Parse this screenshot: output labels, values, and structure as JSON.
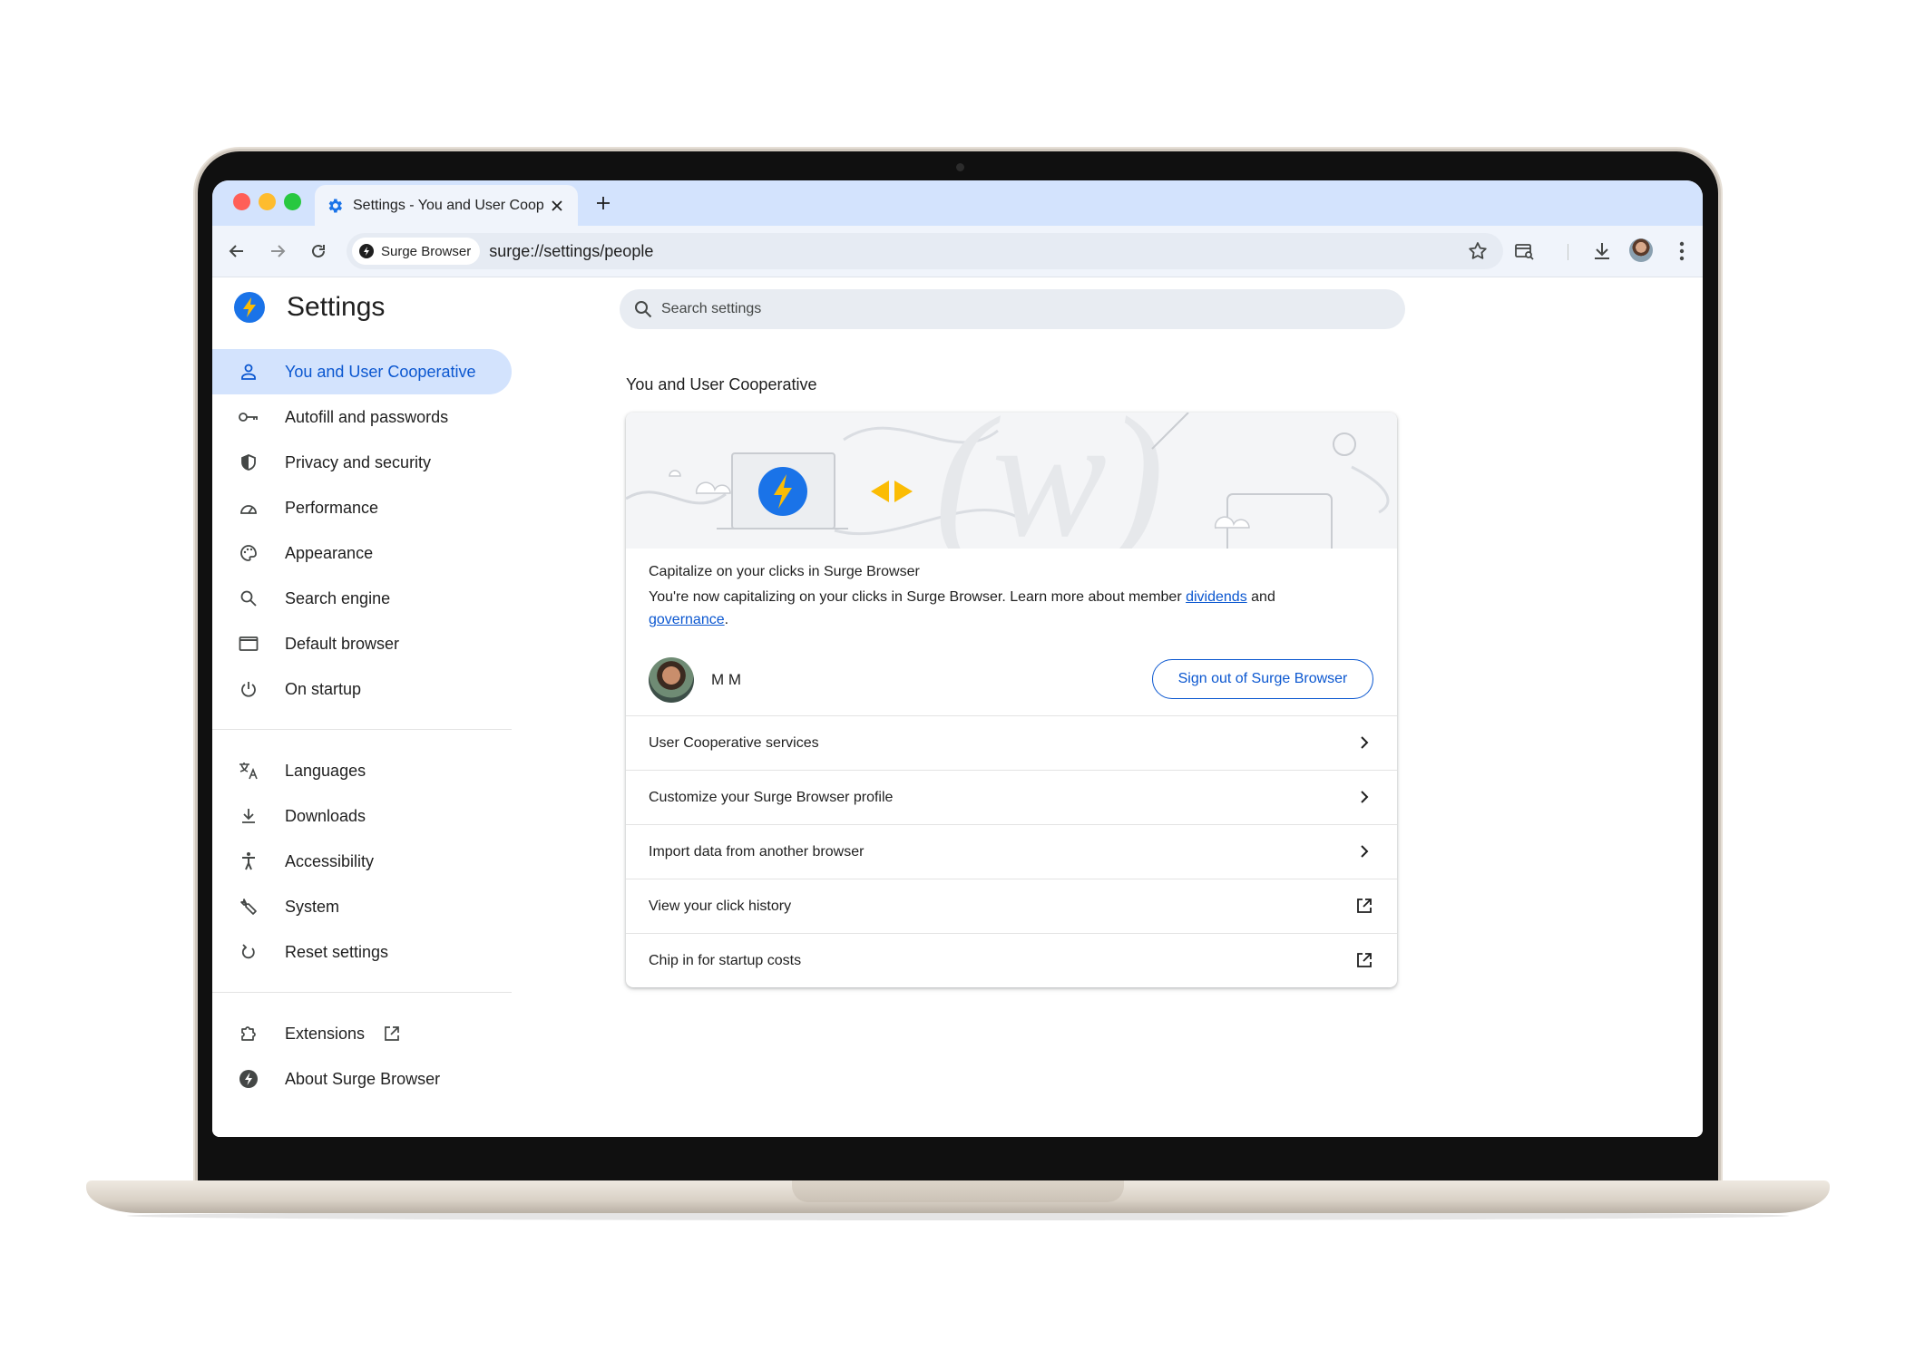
{
  "browser": {
    "tab_title": "Settings - You and User Cooperative",
    "site_chip": "Surge Browser",
    "url": "surge://settings/people"
  },
  "settings": {
    "title": "Settings",
    "search_placeholder": "Search settings",
    "nav": {
      "main": [
        {
          "label": "You and User Cooperative",
          "icon": "person-icon",
          "active": true
        },
        {
          "label": "Autofill and passwords",
          "icon": "key-icon"
        },
        {
          "label": "Privacy and security",
          "icon": "shield-icon"
        },
        {
          "label": "Performance",
          "icon": "speedometer-icon"
        },
        {
          "label": "Appearance",
          "icon": "palette-icon"
        },
        {
          "label": "Search engine",
          "icon": "search-icon"
        },
        {
          "label": "Default browser",
          "icon": "browser-window-icon"
        },
        {
          "label": "On startup",
          "icon": "power-icon"
        }
      ],
      "advanced": [
        {
          "label": "Languages",
          "icon": "translate-icon"
        },
        {
          "label": "Downloads",
          "icon": "download-icon"
        },
        {
          "label": "Accessibility",
          "icon": "accessibility-icon"
        },
        {
          "label": "System",
          "icon": "wrench-icon"
        },
        {
          "label": "Reset settings",
          "icon": "reset-icon"
        }
      ],
      "extras": [
        {
          "label": "Extensions",
          "icon": "puzzle-icon"
        },
        {
          "label": "About Surge Browser",
          "icon": "surge-logo-icon"
        }
      ]
    },
    "section_title": "You and User Cooperative",
    "card": {
      "heading": "Capitalize on your clicks in Surge Browser",
      "description_prefix": "You're now capitalizing on your clicks in Surge Browser. Learn more about member ",
      "link_dividends": "dividends",
      "and_word": " and",
      "link_governance": "governance",
      "period": ".",
      "account_name": "M M",
      "signout_label": "Sign out of Surge Browser",
      "rows": [
        {
          "label": "User Cooperative services",
          "icon": "chevron-right-icon"
        },
        {
          "label": "Customize your Surge Browser profile",
          "icon": "chevron-right-icon"
        },
        {
          "label": "Import data from another browser",
          "icon": "chevron-right-icon"
        },
        {
          "label": "View your click history",
          "icon": "external-link-icon"
        },
        {
          "label": "Chip in for startup costs",
          "icon": "external-link-icon"
        }
      ]
    }
  },
  "colors": {
    "accent": "#0b57d0",
    "logo_blue": "#1a73e8",
    "bolt_yellow": "#fbbc04",
    "tabstrip": "#d3e3fd"
  }
}
